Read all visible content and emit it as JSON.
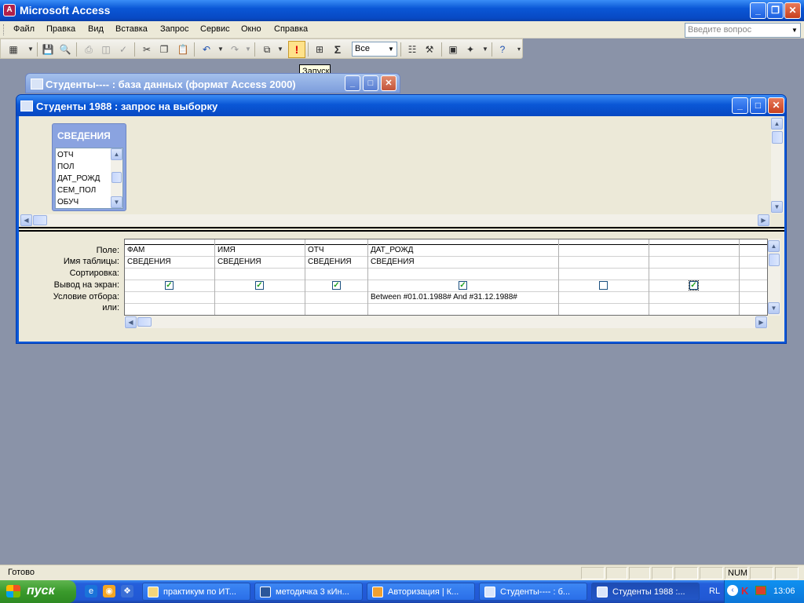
{
  "app": {
    "title": "Microsoft Access",
    "minimize": "_",
    "maximize": "❐",
    "close": "✕"
  },
  "menu": {
    "items": [
      "Файл",
      "Правка",
      "Вид",
      "Вставка",
      "Запрос",
      "Сервис",
      "Окно",
      "Справка"
    ],
    "ask_placeholder": "Введите вопрос"
  },
  "toolbar": {
    "run_label": "!",
    "sigma": "Σ",
    "top_values": "Все",
    "tooltip": "Запуск"
  },
  "db_window": {
    "title": "Студенты---- : база данных (формат Access 2000)"
  },
  "query_window": {
    "title": "Студенты 1988 : запрос на выборку",
    "table": {
      "name": "СВЕДЕНИЯ",
      "fields": [
        "ОТЧ",
        "ПОЛ",
        "ДАТ_РОЖД",
        "СЕМ_ПОЛ",
        "ОБУЧ"
      ]
    },
    "row_labels": [
      "Поле:",
      "Имя таблицы:",
      "Сортировка:",
      "Вывод на экран:",
      "Условие отбора:",
      "или:"
    ],
    "columns": [
      {
        "field": "ФАМ",
        "table": "СВЕДЕНИЯ",
        "show": true,
        "criteria": ""
      },
      {
        "field": "ИМЯ",
        "table": "СВЕДЕНИЯ",
        "show": true,
        "criteria": ""
      },
      {
        "field": "ОТЧ",
        "table": "СВЕДЕНИЯ",
        "show": true,
        "criteria": ""
      },
      {
        "field": "ДАТ_РОЖД",
        "table": "СВЕДЕНИЯ",
        "show": true,
        "criteria": "Between #01.01.1988# And #31.12.1988#"
      },
      {
        "field": "",
        "table": "",
        "show": false,
        "criteria": ""
      },
      {
        "field": "",
        "table": "",
        "show": true,
        "criteria": ""
      },
      {
        "field": "",
        "table": "",
        "show": null,
        "criteria": ""
      }
    ]
  },
  "status": {
    "text": "Готово",
    "num": "NUM"
  },
  "taskbar": {
    "start": "пуск",
    "tasks": [
      "практикум по ИТ...",
      "методичка 3 кИн...",
      "Авторизация | К...",
      "Студенты---- : б...",
      "Студенты 1988 :..."
    ],
    "lang": "RL",
    "time": "13:06"
  }
}
